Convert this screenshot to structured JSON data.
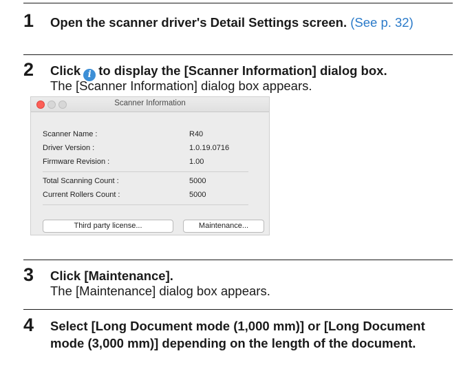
{
  "steps": [
    {
      "number": "1",
      "title": "Open the scanner driver's Detail Settings screen.",
      "link": "(See p. 32)"
    },
    {
      "number": "2",
      "title_before_icon": "Click",
      "title_after_icon": "to display the [Scanner Information] dialog box.",
      "description": "The [Scanner Information] dialog box appears."
    },
    {
      "number": "3",
      "title": "Click [Maintenance].",
      "description": "The [Maintenance] dialog box appears."
    },
    {
      "number": "4",
      "title": "Select [Long Document mode (1,000 mm)] or [Long Document mode (3,000 mm)] depending on the length of the document."
    }
  ],
  "icons": {
    "info": "info-icon"
  },
  "dialog": {
    "title": "Scanner Information",
    "rows": [
      {
        "label": "Scanner Name :",
        "value": "R40"
      },
      {
        "label": "Driver Version :",
        "value": "1.0.19.0716"
      },
      {
        "label": "Firmware Revision :",
        "value": "1.00"
      },
      {
        "label": "Total Scanning Count :",
        "value": "5000"
      },
      {
        "label": "Current Rollers Count :",
        "value": "5000"
      }
    ],
    "buttons": {
      "third_party": "Third party license...",
      "maintenance": "Maintenance..."
    }
  }
}
